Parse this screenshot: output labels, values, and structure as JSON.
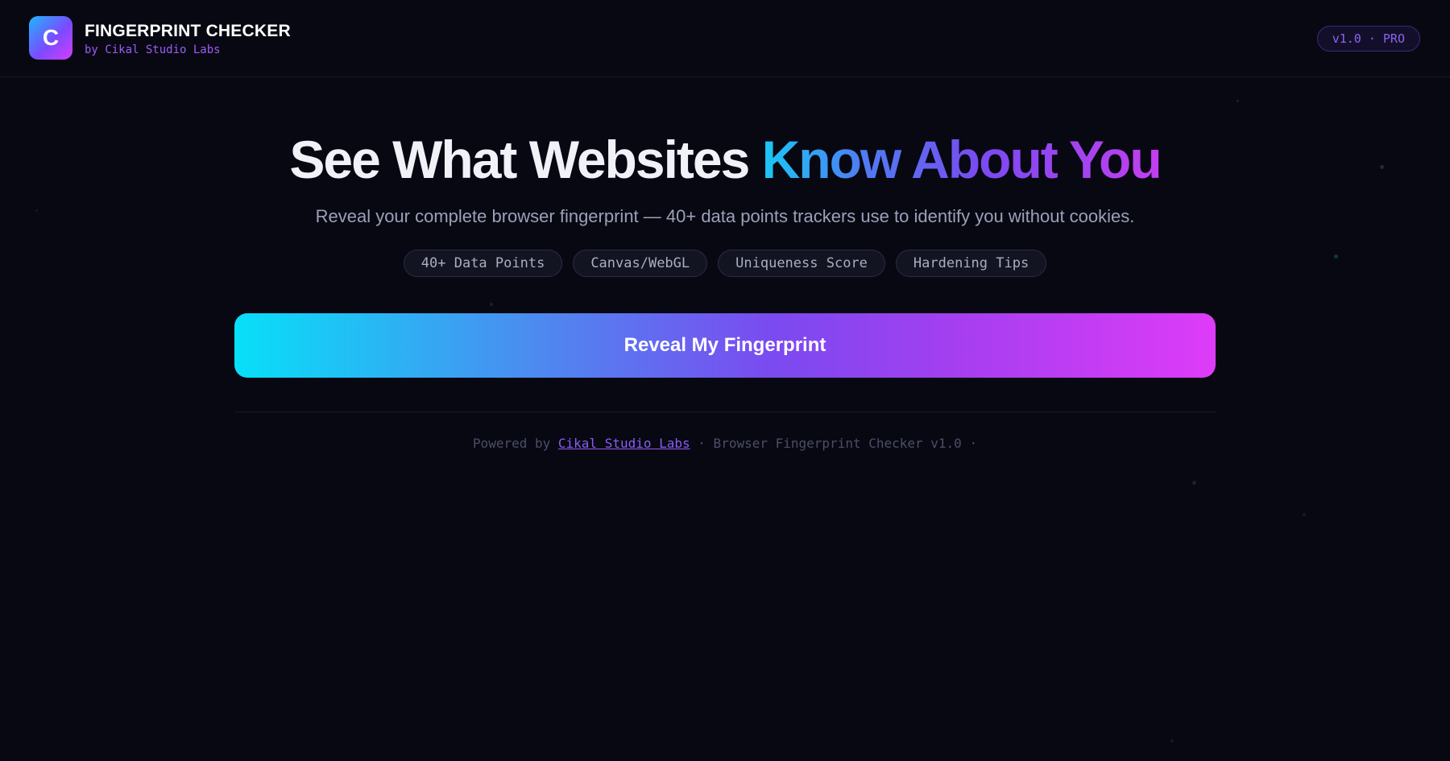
{
  "header": {
    "logo_letter": "C",
    "title": "FINGERPRINT CHECKER",
    "subtitle": "by Cikal Studio Labs",
    "version_badge": "v1.0 · PRO"
  },
  "hero": {
    "title_plain": "See What Websites ",
    "title_accent": "Know About You",
    "subtitle": "Reveal your complete browser fingerprint — 40+ data points trackers use to identify you without cookies.",
    "tags": [
      "40+ Data Points",
      "Canvas/WebGL",
      "Uniqueness Score",
      "Hardening Tips"
    ]
  },
  "cta": {
    "label": "Reveal My Fingerprint"
  },
  "footer": {
    "prefix": "Powered by ",
    "link_text": "Cikal Studio Labs",
    "suffix": " · Browser Fingerprint Checker v1.0 ·"
  },
  "colors": {
    "background": "#080812",
    "accent_cyan": "#07e0f8",
    "accent_purple": "#7b4af0",
    "accent_magenta": "#de3cf8"
  }
}
